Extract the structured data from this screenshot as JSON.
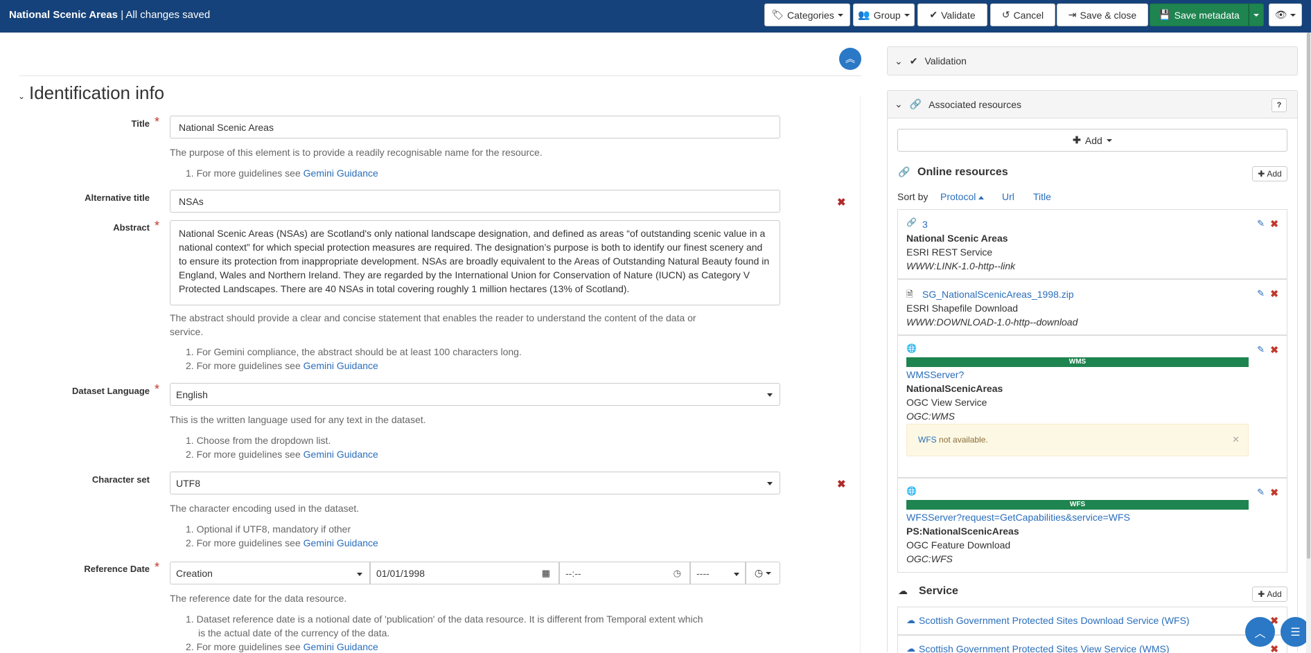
{
  "header": {
    "doc_name": "National Scenic Areas",
    "save_status": "| All changes saved",
    "buttons": {
      "categories": "Categories",
      "group": "Group",
      "validate": "Validate",
      "cancel": "Cancel",
      "save_close": "Save & close",
      "save_metadata": "Save metadata"
    }
  },
  "editor": {
    "section_title": "Identification info",
    "title": {
      "label": "Title",
      "value": "National Scenic Areas",
      "help": "The purpose of this element is to provide a readily recognisable name for the resource.",
      "guide_prefix": "1. For more guidelines see ",
      "guide_link": "Gemini Guidance"
    },
    "alt_title": {
      "label": "Alternative title",
      "value": "NSAs"
    },
    "abstract": {
      "label": "Abstract",
      "value": "National Scenic Areas (NSAs) are Scotland's only national landscape designation, and defined as areas “of outstanding scenic value in a national context” for which special protection measures are required. The designation’s purpose is both to identify our finest scenery and to ensure its protection from inappropriate development. NSAs are broadly equivalent to the Areas of Outstanding Natural Beauty found in England, Wales and Northern Ireland. They are regarded by the International Union for Conservation of Nature (IUCN) as Category V Protected Landscapes. There are 40 NSAs in total covering roughly 1 million hectares (13% of Scotland).",
      "help": "The abstract should provide a clear and concise statement that enables the reader to understand the content of the data or service.",
      "guide_1": "1. For Gemini compliance, the abstract should be at least 100 characters long.",
      "guide_2_prefix": "2. For more guidelines see ",
      "guide_link": "Gemini Guidance"
    },
    "language": {
      "label": "Dataset Language",
      "value": "English",
      "help": "This is the written language used for any text in the dataset.",
      "guide_1": "1. Choose from the dropdown list.",
      "guide_2_prefix": "2. For more guidelines see ",
      "guide_link": "Gemini Guidance"
    },
    "charset": {
      "label": "Character set",
      "value": "UTF8",
      "help": "The character encoding used in the dataset.",
      "guide_1": "1. Optional if UTF8, mandatory if other",
      "guide_2_prefix": "2. For more guidelines see ",
      "guide_link": "Gemini Guidance"
    },
    "ref_date": {
      "label": "Reference Date",
      "type": "Creation",
      "date": "01/01/1998",
      "time": "--:--",
      "tz": "----",
      "help": "The reference date for the data resource.",
      "guide_1a": "1. Dataset reference date is a notional date of 'publication' of the data resource. It is different from Temporal extent which",
      "guide_1b": "is the actual date of the currency of the data.",
      "guide_2_prefix": "2. For more guidelines see ",
      "guide_link": "Gemini Guidance"
    }
  },
  "sidebar": {
    "validation_title": "Validation",
    "assoc_title": "Associated resources",
    "add_label": "Add",
    "online_title": "Online resources",
    "online_add": "Add",
    "sort_by": "Sort by",
    "sort_protocol": "Protocol",
    "sort_url": "Url",
    "sort_title": "Title",
    "resources": [
      {
        "link": "3",
        "name": "National Scenic Areas",
        "desc": "ESRI REST Service",
        "protocol": "WWW:LINK-1.0-http--link"
      },
      {
        "link": "SG_NationalScenicAreas_1998.zip",
        "desc": "ESRI Shapefile Download",
        "protocol": "WWW:DOWNLOAD-1.0-http--download"
      },
      {
        "badge": "WMS",
        "link": "WMSServer?",
        "name": "NationalScenicAreas",
        "desc": "OGC View Service",
        "protocol": "OGC:WMS",
        "alert_link": "WFS",
        "alert_text": "not available."
      },
      {
        "badge": "WFS",
        "link": "WFSServer?request=GetCapabilities&service=WFS",
        "name": "PS:NationalScenicAreas",
        "desc": "OGC Feature Download",
        "protocol": "OGC:WFS"
      }
    ],
    "service_title": "Service",
    "service_add": "Add",
    "services": [
      "Scottish Government Protected Sites Download Service (WFS)",
      "Scottish Government Protected Sites View Service (WMS)"
    ]
  },
  "colors": {
    "header": "#15427a",
    "primary": "#2a78c6",
    "success": "#1e8450",
    "danger": "#c0392b",
    "link": "#2a6ebb"
  }
}
